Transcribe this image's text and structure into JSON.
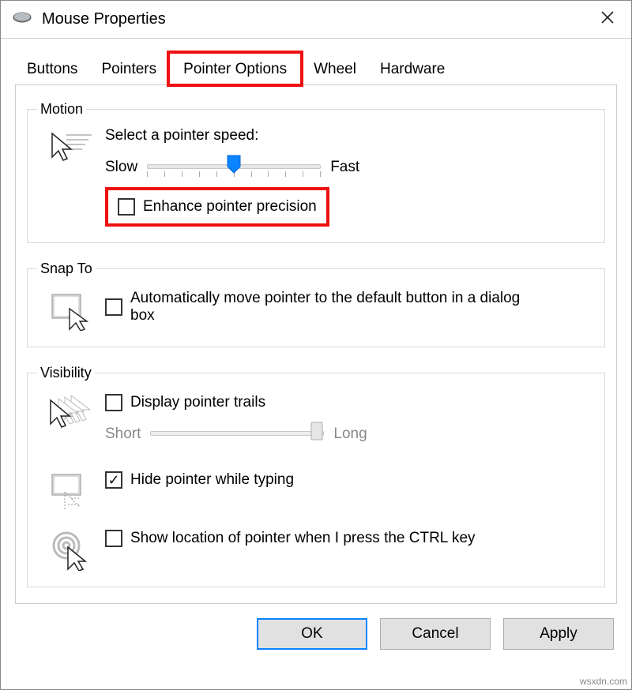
{
  "window": {
    "title": "Mouse Properties"
  },
  "tabs": {
    "buttons": "Buttons",
    "pointers": "Pointers",
    "pointer_options": "Pointer Options",
    "wheel": "Wheel",
    "hardware": "Hardware",
    "active": "pointer_options"
  },
  "motion": {
    "legend": "Motion",
    "speed_label": "Select a pointer speed:",
    "slow": "Slow",
    "fast": "Fast",
    "speed_value": 6,
    "speed_min": 1,
    "speed_max": 11,
    "enhance_label": "Enhance pointer precision",
    "enhance_checked": false
  },
  "snapto": {
    "legend": "Snap To",
    "auto_label": "Automatically move pointer to the default button in a dialog box",
    "auto_checked": false
  },
  "visibility": {
    "legend": "Visibility",
    "trails_label": "Display pointer trails",
    "trails_checked": false,
    "short": "Short",
    "long": "Long",
    "trails_value": 7,
    "hide_label": "Hide pointer while typing",
    "hide_checked": true,
    "ctrl_label": "Show location of pointer when I press the CTRL key",
    "ctrl_checked": false
  },
  "buttons": {
    "ok": "OK",
    "cancel": "Cancel",
    "apply": "Apply"
  },
  "watermark": "wsxdn.com"
}
